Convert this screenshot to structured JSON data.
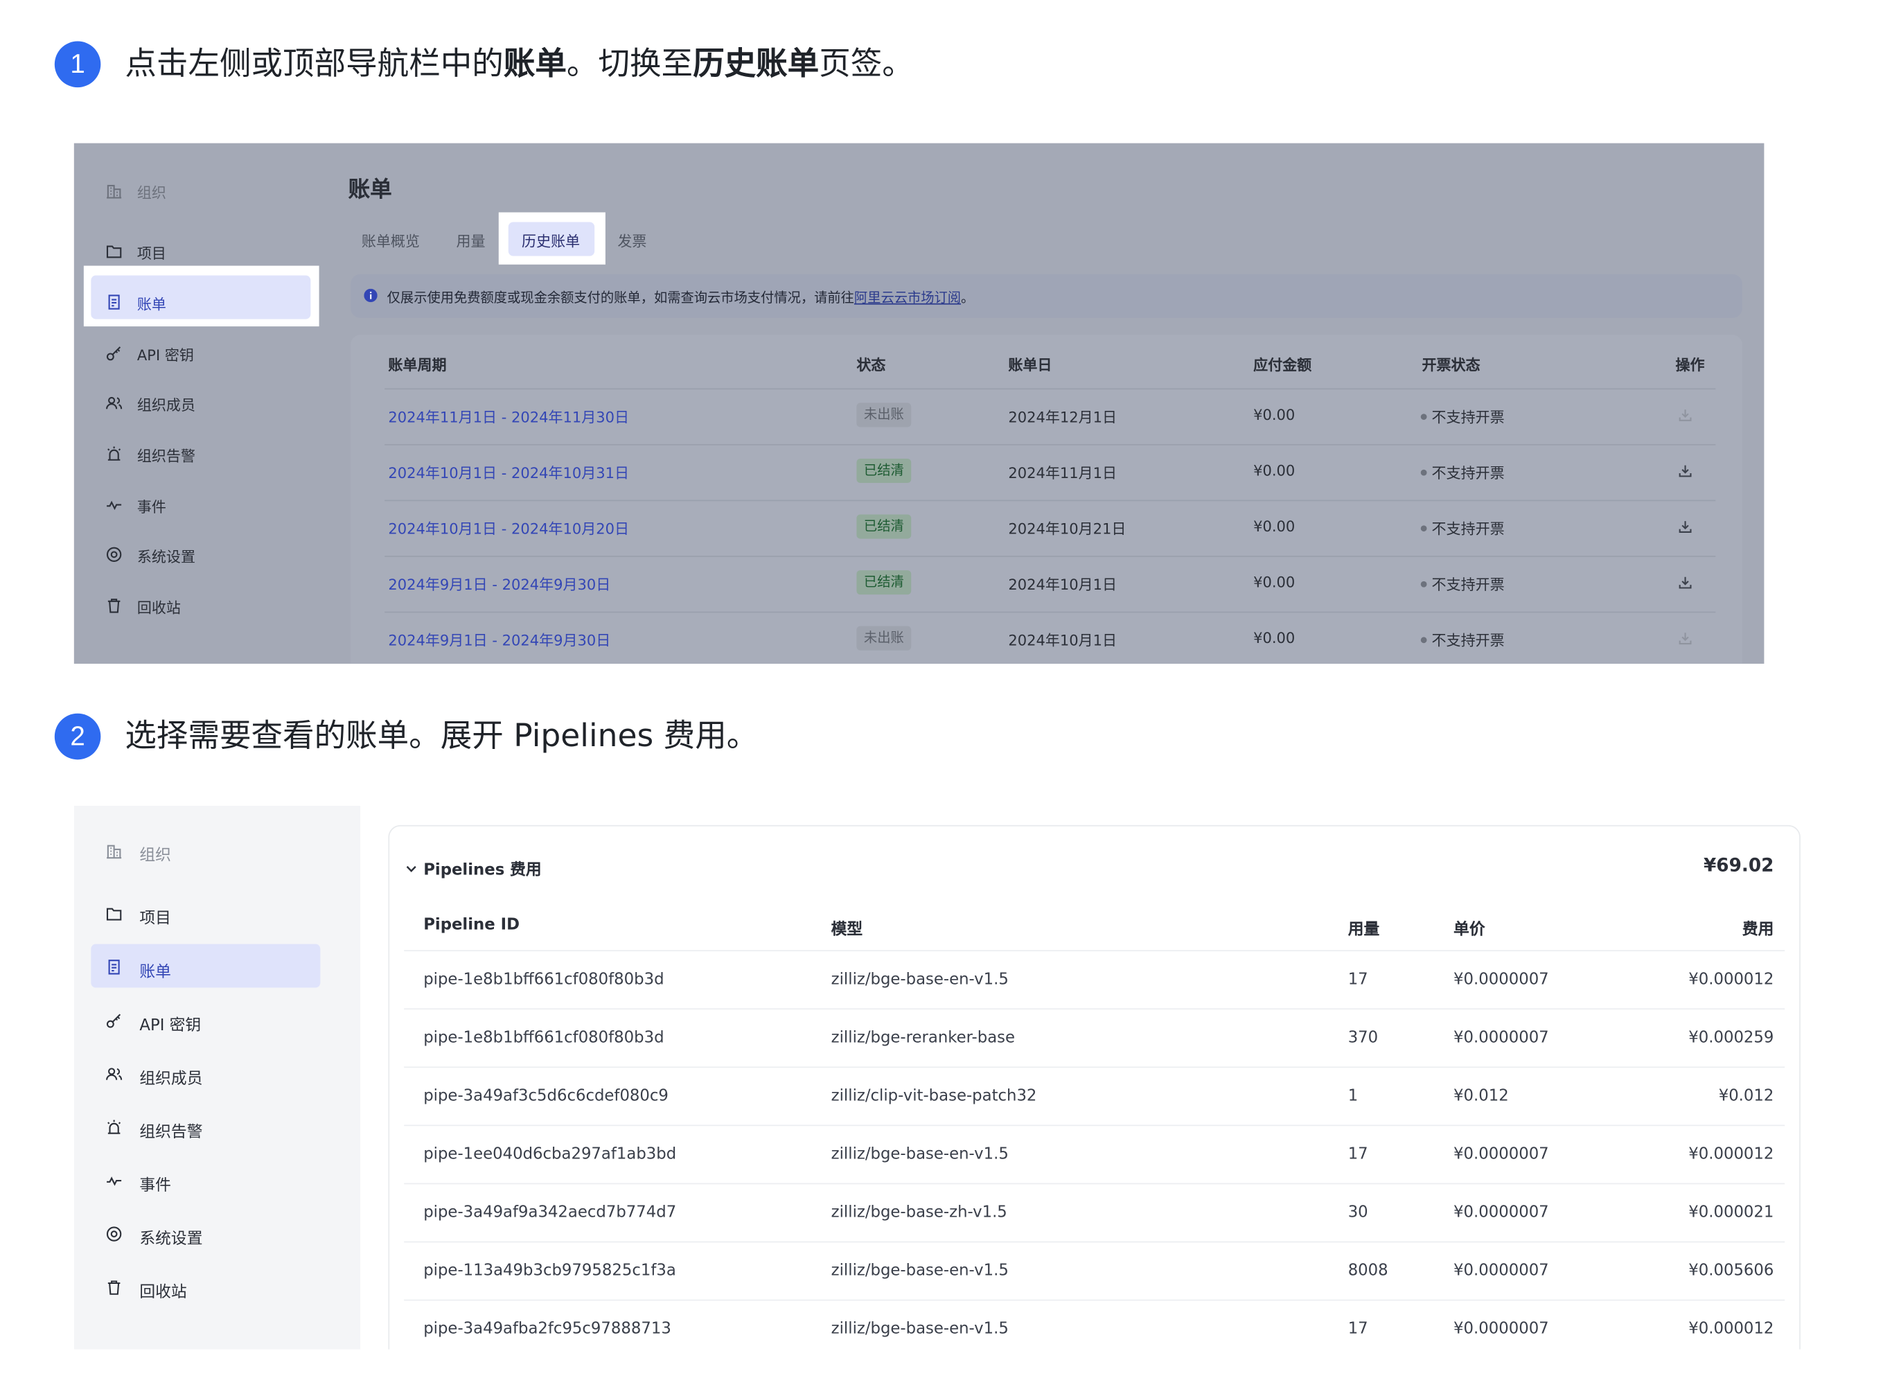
{
  "step1": {
    "number": "1",
    "text_a": "点击左侧或顶部导航栏中的",
    "text_b": "账单",
    "text_c": "。切换至",
    "text_d": "历史账单",
    "text_e": "页签。"
  },
  "step2": {
    "number": "2",
    "text": "选择需要查看的账单。展开 Pipelines 费用。"
  },
  "shot1": {
    "sidebar": [
      {
        "label": "组织",
        "icon": "building-icon"
      },
      {
        "label": "项目",
        "icon": "folder-icon"
      },
      {
        "label": "账单",
        "icon": "bill-icon"
      },
      {
        "label": "API 密钥",
        "icon": "key-icon"
      },
      {
        "label": "组织成员",
        "icon": "members-icon"
      },
      {
        "label": "组织告警",
        "icon": "alarm-icon"
      },
      {
        "label": "事件",
        "icon": "activity-icon"
      },
      {
        "label": "系统设置",
        "icon": "settings-icon"
      },
      {
        "label": "回收站",
        "icon": "trash-icon"
      }
    ],
    "title": "账单",
    "tabs": [
      "账单概览",
      "用量",
      "历史账单",
      "发票"
    ],
    "info_prefix": "仅展示使用免费额度或现金余额支付的账单，如需查询云市场支付情况，请前往",
    "info_link": "阿里云云市场订阅",
    "info_suffix": "。",
    "columns": [
      "账单周期",
      "状态",
      "账单日",
      "应付金额",
      "开票状态",
      "操作"
    ],
    "rows": [
      {
        "period": "2024年11月1日 - 2024年11月30日",
        "status": "未出账",
        "status_type": "unbilled",
        "bill_date": "2024年12月1日",
        "amount": "¥0.00",
        "invoice": "不支持开票"
      },
      {
        "period": "2024年10月1日 - 2024年10月31日",
        "status": "已结清",
        "status_type": "settled",
        "bill_date": "2024年11月1日",
        "amount": "¥0.00",
        "invoice": "不支持开票"
      },
      {
        "period": "2024年10月1日 - 2024年10月20日",
        "status": "已结清",
        "status_type": "settled",
        "bill_date": "2024年10月21日",
        "amount": "¥0.00",
        "invoice": "不支持开票"
      },
      {
        "period": "2024年9月1日 - 2024年9月30日",
        "status": "已结清",
        "status_type": "settled",
        "bill_date": "2024年10月1日",
        "amount": "¥0.00",
        "invoice": "不支持开票"
      },
      {
        "period": "2024年9月1日 - 2024年9月30日",
        "status": "未出账",
        "status_type": "unbilled",
        "bill_date": "2024年10月1日",
        "amount": "¥0.00",
        "invoice": "不支持开票"
      }
    ]
  },
  "shot2": {
    "sidebar": [
      {
        "label": "组织",
        "icon": "building-icon"
      },
      {
        "label": "项目",
        "icon": "folder-icon"
      },
      {
        "label": "账单",
        "icon": "bill-icon"
      },
      {
        "label": "API 密钥",
        "icon": "key-icon"
      },
      {
        "label": "组织成员",
        "icon": "members-icon"
      },
      {
        "label": "组织告警",
        "icon": "alarm-icon"
      },
      {
        "label": "事件",
        "icon": "activity-icon"
      },
      {
        "label": "系统设置",
        "icon": "settings-icon"
      },
      {
        "label": "回收站",
        "icon": "trash-icon"
      }
    ],
    "section_title": "Pipelines 费用",
    "section_total": "¥69.02",
    "columns": [
      "Pipeline ID",
      "模型",
      "用量",
      "单价",
      "费用"
    ],
    "rows": [
      {
        "id": "pipe-1e8b1bff661cf080f80b3d",
        "model": "zilliz/bge-base-en-v1.5",
        "usage": "17",
        "unit_price": "¥0.0000007",
        "cost": "¥0.000012"
      },
      {
        "id": "pipe-1e8b1bff661cf080f80b3d",
        "model": "zilliz/bge-reranker-base",
        "usage": "370",
        "unit_price": "¥0.0000007",
        "cost": "¥0.000259"
      },
      {
        "id": "pipe-3a49af3c5d6c6cdef080c9",
        "model": "zilliz/clip-vit-base-patch32",
        "usage": "1",
        "unit_price": "¥0.012",
        "cost": "¥0.012"
      },
      {
        "id": "pipe-1ee040d6cba297af1ab3bd",
        "model": "zilliz/bge-base-en-v1.5",
        "usage": "17",
        "unit_price": "¥0.0000007",
        "cost": "¥0.000012"
      },
      {
        "id": "pipe-3a49af9a342aecd7b774d7",
        "model": "zilliz/bge-base-zh-v1.5",
        "usage": "30",
        "unit_price": "¥0.0000007",
        "cost": "¥0.000021"
      },
      {
        "id": "pipe-113a49b3cb9795825c1f3a",
        "model": "zilliz/bge-base-en-v1.5",
        "usage": "8008",
        "unit_price": "¥0.0000007",
        "cost": "¥0.005606"
      },
      {
        "id": "pipe-3a49afba2fc95c97888713",
        "model": "zilliz/bge-base-en-v1.5",
        "usage": "17",
        "unit_price": "¥0.0000007",
        "cost": "¥0.000012"
      }
    ]
  },
  "colors": {
    "step_circle": "#2f6bf0",
    "active_nav_bg": "#dfe3fb",
    "active_nav_text": "#3346b5",
    "link": "#3346b5",
    "settled_text": "#1d5b32"
  }
}
